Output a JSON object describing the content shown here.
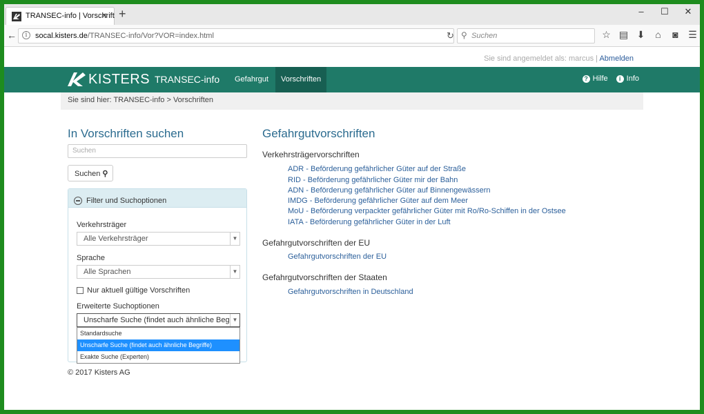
{
  "browser": {
    "tab_title": "TRANSEC-info | Vorschrift",
    "tab_close": "×",
    "new_tab": "+",
    "url_host": "socal.kisters.de",
    "url_path": "/TRANSEC-info/Vor?VOR=index.html",
    "search_placeholder": "Suchen",
    "window_buttons": [
      "–",
      "☐",
      "✕"
    ]
  },
  "account": {
    "logged_in_text": "Sie sind angemeldet als: marcus |",
    "logout_label": "Abmelden"
  },
  "header": {
    "logo_text": "KISTERS",
    "brand": "TRANSEC-info",
    "nav": [
      "Gefahrgut",
      "Vorschriften"
    ],
    "active_nav": "Vorschriften",
    "help_label": "Hilfe",
    "info_label": "Info",
    "accent": "#1f7a68"
  },
  "breadcrumb": "Sie sind hier: TRANSEC-info > Vorschriften",
  "search_panel": {
    "title": "In Vorschriften suchen",
    "placeholder": "Suchen",
    "button_label": "Suchen",
    "filter_title": "Filter und Suchoptionen",
    "carrier_label": "Verkehrsträger",
    "carrier_value": "Alle Verkehrsträger",
    "language_label": "Sprache",
    "language_value": "Alle Sprachen",
    "only_valid_label": "Nur aktuell gültige Vorschriften",
    "only_valid_checked": false,
    "advanced_label": "Erweiterte Suchoptionen",
    "advanced_value": "Unscharfe Suche (findet auch ähnliche Begriffe)",
    "advanced_options": [
      "Standardsuche",
      "Unscharfe Suche (findet auch ähnliche Begriffe)",
      "Exakte Suche (Experten)"
    ]
  },
  "content": {
    "title": "Gefahrgutvorschriften",
    "sections": [
      {
        "heading": "Verkehrsträgervorschriften",
        "links": [
          "ADR - Beförderung gefährlicher Güter auf der Straße",
          "RID - Beförderung gefährlicher Güter mir der Bahn",
          "ADN - Beförderung gefährlicher Güter auf Binnengewässern",
          "IMDG - Beförderung gefährlicher Güter auf dem Meer",
          "MoU - Beförderung verpackter gefährlicher Güter mit Ro/Ro-Schiffen in der Ostsee",
          "IATA - Beförderung gefährlicher Güter in der Luft"
        ]
      },
      {
        "heading": "Gefahrgutvorschriften der EU",
        "links": [
          "Gefahrgutvorschriften der EU"
        ]
      },
      {
        "heading": "Gefahrgutvorschriften der Staaten",
        "links": [
          "Gefahrgutvorschriften in Deutschland"
        ]
      }
    ]
  },
  "footer": "© 2017 Kisters AG"
}
